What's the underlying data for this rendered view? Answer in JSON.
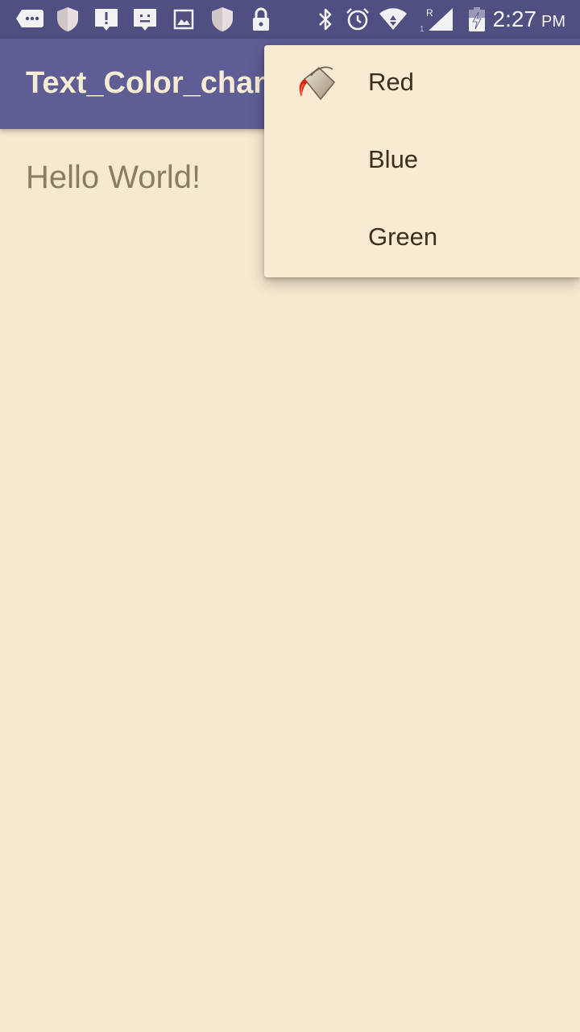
{
  "status_bar": {
    "time": "2:27",
    "ampm": "PM",
    "icons": [
      "chat-bubble-icon",
      "shield-icon",
      "alert-icon",
      "face-icon",
      "image-icon",
      "shield-icon",
      "lock-icon",
      "bluetooth-icon",
      "alarm-icon",
      "wifi-icon",
      "signal-icon",
      "battery-charging-icon"
    ],
    "signal_tag_top": "R",
    "signal_tag_bottom": "1"
  },
  "app_bar": {
    "title": "Text_Color_changer"
  },
  "content": {
    "hello_text": "Hello World!"
  },
  "menu": {
    "items": [
      {
        "label": "Red",
        "icon": "paint-bucket-icon"
      },
      {
        "label": "Blue"
      },
      {
        "label": "Green"
      }
    ]
  },
  "colors": {
    "status_bar": "#4f4f82",
    "app_bar": "#5e5e94",
    "background": "#f7e9cf",
    "menu_background": "#f8ebd2",
    "menu_text": "#3c2f1d",
    "hello_text": "#8d7c62"
  }
}
